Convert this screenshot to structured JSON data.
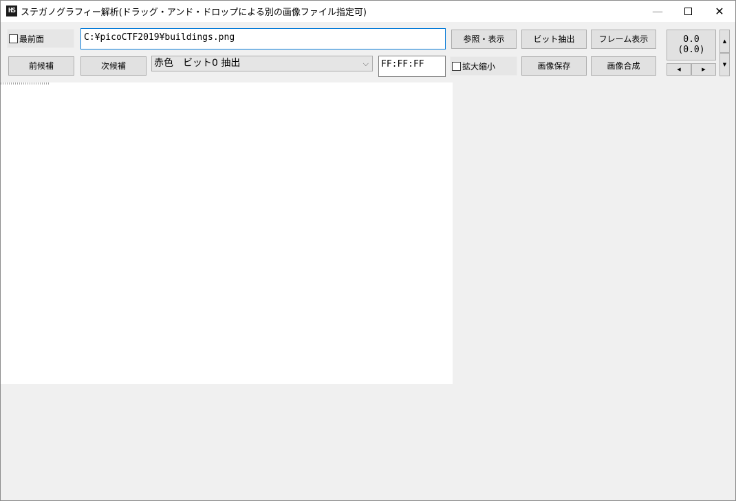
{
  "window": {
    "icon_text": "HS",
    "title": "ステガノグラフィー解析(ドラッグ・アンド・ドロップによる別の画像ファイル指定可)",
    "controls": {
      "minimize": "—",
      "close": "✕"
    }
  },
  "toolbar": {
    "topmost_label": "最前面",
    "file_path": "C:¥picoCTF2019¥buildings.png",
    "browse_label": "参照・表示",
    "bit_extract_label": "ビット抽出",
    "frame_view_label": "フレーム表示",
    "prev_candidate_label": "前候補",
    "next_candidate_label": "次候補",
    "mode_selected": "赤色　ビット0 抽出",
    "color_value": "FF:FF:FF",
    "zoom_label": "拡大縮小",
    "save_image_label": "画像保存",
    "composite_label": "画像合成"
  },
  "coords": {
    "line1": "0.0",
    "line2": "(0.0)"
  },
  "icons": {
    "up": "▲",
    "down": "▼",
    "left": "◀",
    "right": "▶",
    "dropdown": "⌵"
  }
}
